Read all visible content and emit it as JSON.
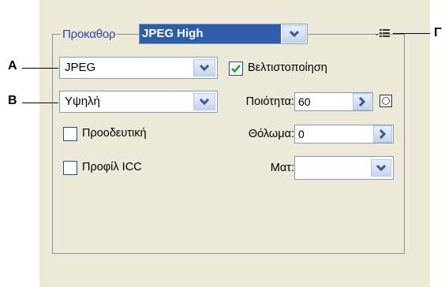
{
  "preset": {
    "label": "Προκαθορ",
    "value": "JPEG High"
  },
  "callouts": {
    "a": "A",
    "b": "B",
    "c": "Γ"
  },
  "format": {
    "value": "JPEG"
  },
  "quality_level": {
    "value": "Υψηλή"
  },
  "optimize": {
    "label": "Βελτιστοποίηση",
    "checked": true
  },
  "quality": {
    "label": "Ποιότητα:",
    "value": "60"
  },
  "progressive": {
    "label": "Προοδευτική",
    "checked": false
  },
  "blur": {
    "label": "Θόλωμα:",
    "value": "0"
  },
  "icc_profile": {
    "label": "Προφίλ ICC",
    "checked": false
  },
  "matte": {
    "label": "Ματ:",
    "value": ""
  },
  "icons": {
    "menu": "panel-menu-icon",
    "dropdown": "chevron-down-icon",
    "arrow": "arrow-right-icon",
    "mask": "mask-icon",
    "check": "checkmark-icon"
  }
}
